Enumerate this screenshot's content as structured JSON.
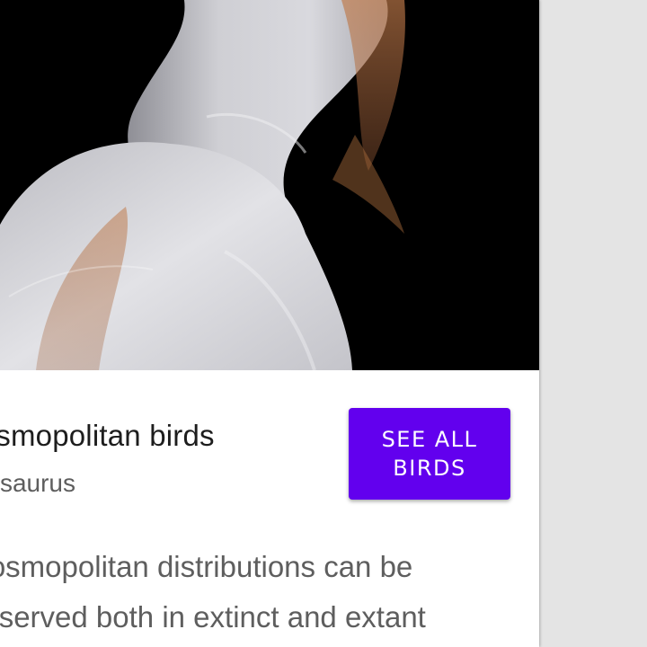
{
  "hero": {
    "image_name": "cattle-egret-neck-photo",
    "background": "#000000"
  },
  "card": {
    "title": "cosmopolitan birds",
    "subtitle": "Aviasaurus",
    "description_line1": "Cosmopolitan distributions can be",
    "description_line2": "observed both in extinct and extant"
  },
  "cta": {
    "label": "SEE ALL BIRDS",
    "color": "#6200ee"
  }
}
